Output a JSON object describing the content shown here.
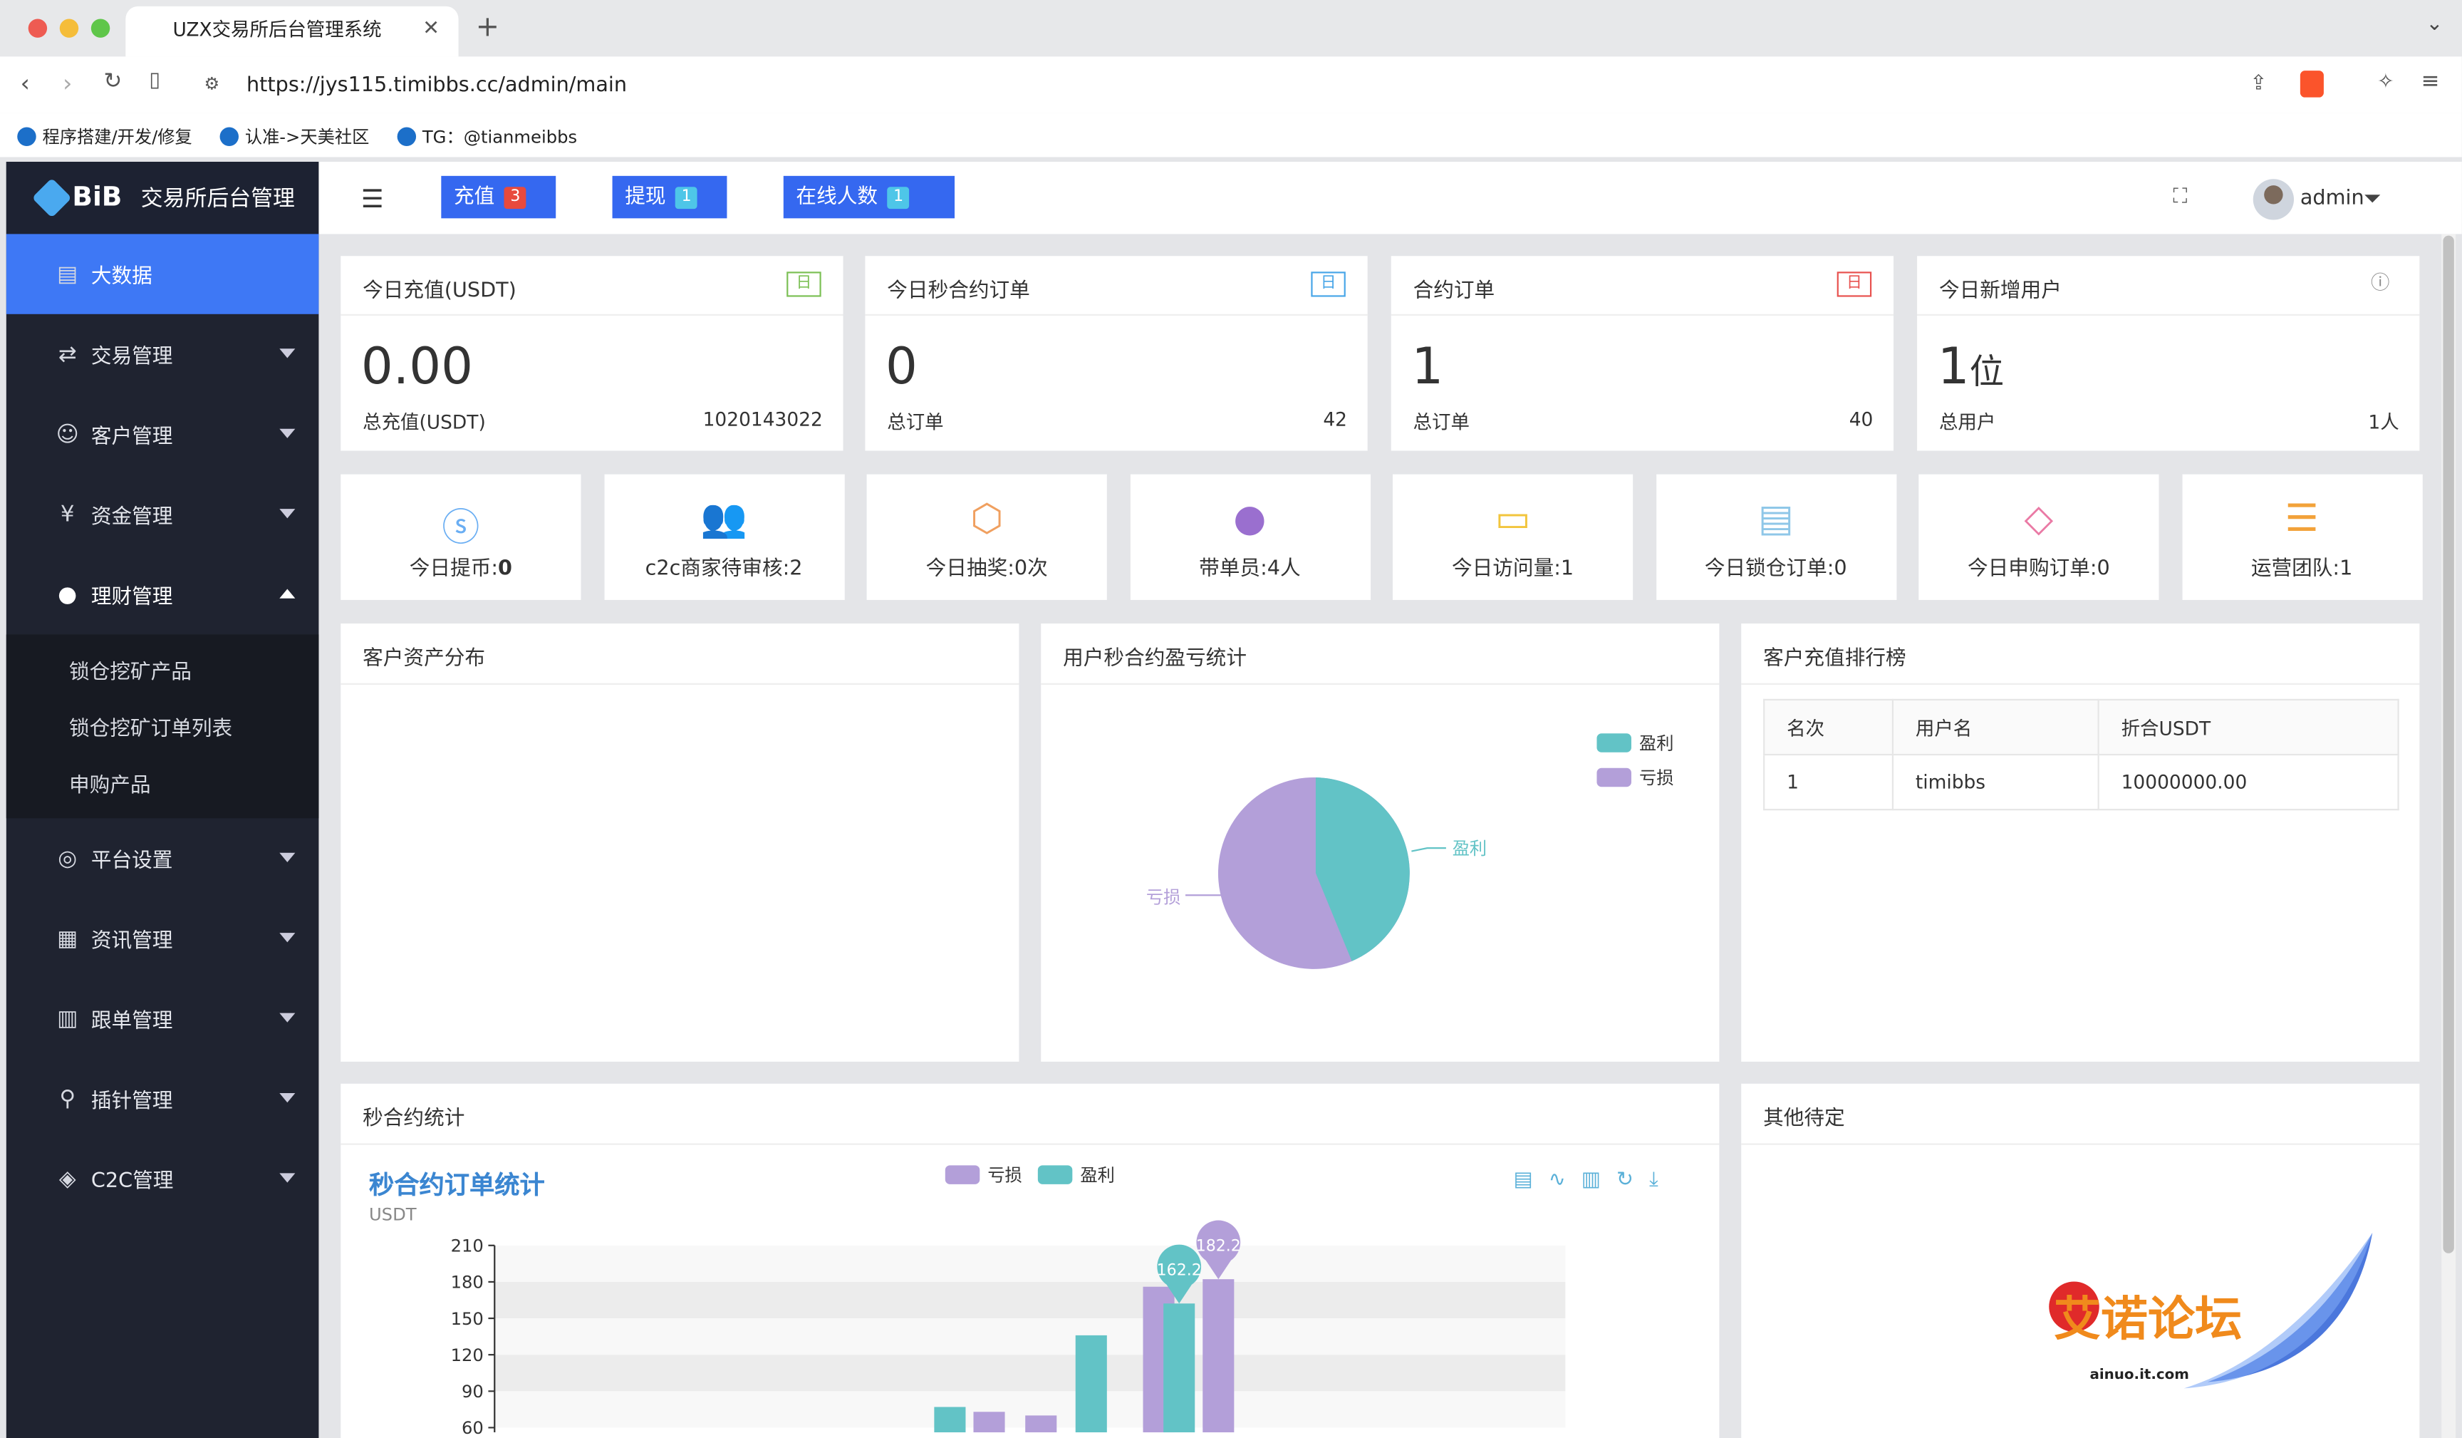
{
  "browser": {
    "tab_title": "UZX交易所后台管理系统",
    "url": "https://jys115.timibbs.cc/admin/main",
    "bookmarks": [
      "程序搭建/开发/修复",
      "认准->天美社区",
      "TG：@tianmeibbs"
    ]
  },
  "sidebar": {
    "brand": "BiB",
    "title": "交易所后台管理",
    "items": [
      {
        "label": "大数据",
        "icon": "chart-icon",
        "active": true
      },
      {
        "label": "交易管理",
        "icon": "transfer-icon"
      },
      {
        "label": "客户管理",
        "icon": "users-icon"
      },
      {
        "label": "资金管理",
        "icon": "money-icon"
      },
      {
        "label": "理财管理",
        "icon": "piggy-icon",
        "expanded": true
      },
      {
        "label": "平台设置",
        "icon": "settings-icon"
      },
      {
        "label": "资讯管理",
        "icon": "news-icon"
      },
      {
        "label": "跟单管理",
        "icon": "doc-icon"
      },
      {
        "label": "插针管理",
        "icon": "pin-icon"
      },
      {
        "label": "C2C管理",
        "icon": "c2c-icon"
      }
    ],
    "subitems": [
      "锁仓挖矿产品",
      "锁仓挖矿订单列表",
      "申购产品"
    ]
  },
  "topbar": {
    "recharge": "充值",
    "recharge_count": "3",
    "withdraw": "提现",
    "withdraw_count": "1",
    "online": "在线人数",
    "online_count": "1",
    "user": "admin"
  },
  "stats": [
    {
      "title": "今日充值(USDT)",
      "tag": "日",
      "value": "0.00",
      "sub_label": "总充值(USDT)",
      "sub_value": "1020143022",
      "tag_color": "#7cc055"
    },
    {
      "title": "今日秒合约订单",
      "tag": "日",
      "value": "0",
      "sub_label": "总订单",
      "sub_value": "42",
      "tag_color": "#49a6e8"
    },
    {
      "title": "合约订单",
      "tag": "日",
      "value": "1",
      "sub_label": "总订单",
      "sub_value": "40",
      "tag_color": "#e8524f"
    },
    {
      "title": "今日新增用户",
      "tag": "ⓘ",
      "value": "1",
      "value_unit": "位",
      "sub_label": "总用户",
      "sub_value": "1人",
      "tag_color": "#888888"
    }
  ],
  "quick": [
    {
      "label": "今日提币:",
      "value": "0",
      "icon": "dollar-icon",
      "color": "#6aaef3"
    },
    {
      "label": "c2c商家待审核:2",
      "icon": "group-icon",
      "color": "#6fcf4e"
    },
    {
      "label": "今日抽奖:0次",
      "icon": "box-icon",
      "color": "#f0a060"
    },
    {
      "label": "带单员:4人",
      "icon": "person-icon",
      "color": "#9a6fcf"
    },
    {
      "label": "今日访问量:1",
      "icon": "window-icon",
      "color": "#f2c53d"
    },
    {
      "label": "今日锁仓订单:0",
      "icon": "file-icon",
      "color": "#8fc7e8"
    },
    {
      "label": "今日申购订单:0",
      "icon": "tag-icon",
      "color": "#ea7aa5"
    },
    {
      "label": "运营团队:1",
      "icon": "sliders-icon",
      "color": "#f2a23a"
    }
  ],
  "panels": {
    "asset": "客户资产分布",
    "pnl": "用户秒合约盈亏统计",
    "rank": "客户充值排行榜",
    "seconds": "秒合约统计",
    "other": "其他待定"
  },
  "pie": {
    "legend": [
      "盈利",
      "亏损"
    ],
    "label_profit": "盈利",
    "label_loss": "亏损",
    "colors": {
      "profit": "#62c3c6",
      "loss": "#b39fd9"
    }
  },
  "rank_table": {
    "headers": [
      "名次",
      "用户名",
      "折合USDT"
    ],
    "rows": [
      [
        "1",
        "timibbs",
        "10000000.00"
      ]
    ]
  },
  "chart_data": {
    "type": "bar",
    "title": "秒合约订单统计",
    "ylabel": "USDT",
    "legend": [
      "亏损",
      "盈利"
    ],
    "yticks": [
      60,
      90,
      120,
      150,
      180,
      210
    ],
    "series": [
      {
        "name": "亏损",
        "color": "#b39fd9",
        "values": [
          73,
          70,
          176,
          182.2
        ]
      },
      {
        "name": "盈利",
        "color": "#62c3c6",
        "values": [
          77,
          136,
          162.2
        ]
      }
    ],
    "markers": [
      "162.2",
      "182.2"
    ]
  },
  "watermark": {
    "text": "艾诺论坛",
    "sub": "ainuo.it.com"
  }
}
